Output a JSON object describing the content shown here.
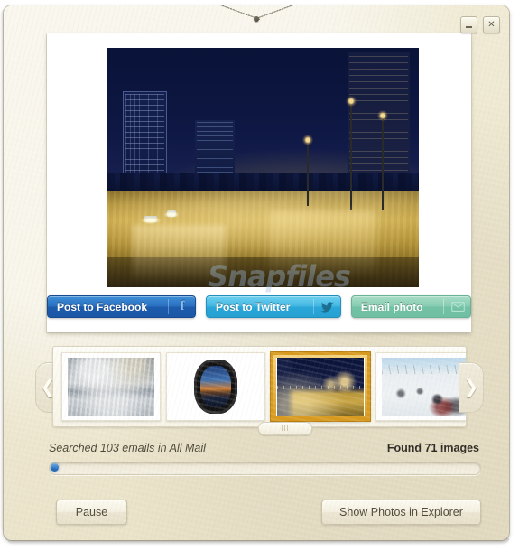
{
  "window": {
    "controls": [
      {
        "name": "minimize",
        "label": "–"
      },
      {
        "name": "close",
        "label": "×"
      }
    ]
  },
  "photo": {
    "watermark": "Snapfiles",
    "alt": "Night cityscape with illuminated office towers, street lamps and a wide lit road",
    "hanger_icon": "picture-hanger-nail"
  },
  "social": {
    "facebook": {
      "label": "Post to Facebook",
      "icon": "facebook-f-icon",
      "color": "#2a6fc0"
    },
    "twitter": {
      "label": "Post to Twitter",
      "icon": "twitter-bird-icon",
      "color": "#41b6e2"
    },
    "email": {
      "label": "Email photo",
      "icon": "envelope-icon",
      "color": "#84ccb2"
    }
  },
  "filmstrip": {
    "prev_icon": "chevron-left-icon",
    "next_icon": "chevron-right-icon",
    "selected_index": 2,
    "thumbs": [
      {
        "name": "thumb-clouds",
        "alt": "Aerial view of clouds at sunset from an airplane",
        "selected": false
      },
      {
        "name": "thumb-airplane-window",
        "alt": "Sunset horizon seen through an airplane window",
        "selected": false
      },
      {
        "name": "thumb-night-city",
        "alt": "Night cityscape with lit road",
        "selected": true
      },
      {
        "name": "thumb-snow-hill",
        "alt": "People sledding on a snowy hill",
        "selected": false
      }
    ]
  },
  "status": {
    "searched": "Searched 103 emails in All Mail",
    "found": "Found 71 images",
    "progress_percent": 2
  },
  "actions": {
    "pause": "Pause",
    "show_in_explorer": "Show Photos in Explorer"
  }
}
